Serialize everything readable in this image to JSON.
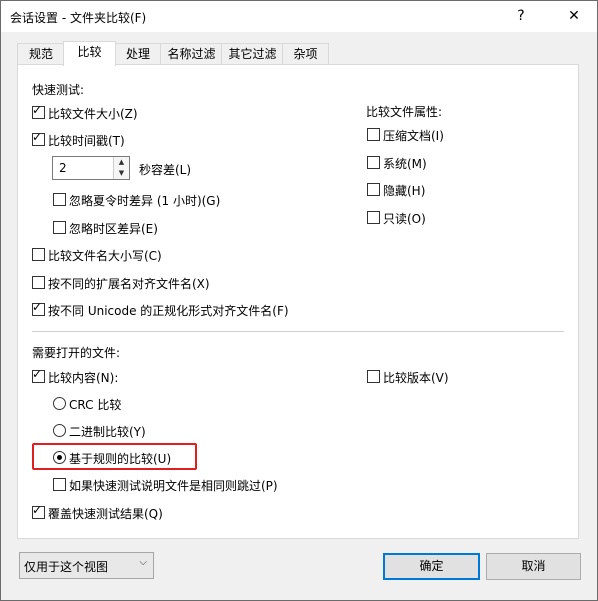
{
  "window": {
    "title": "会话设置 - 文件夹比较(F)",
    "help_label": "?",
    "close_label": "✕"
  },
  "tabs": [
    {
      "label": "规范"
    },
    {
      "label": "比较"
    },
    {
      "label": "处理"
    },
    {
      "label": "名称过滤"
    },
    {
      "label": "其它过滤"
    },
    {
      "label": "杂项"
    }
  ],
  "quick_test": {
    "heading": "快速测试:",
    "compare_size": {
      "label": "比较文件大小(Z)",
      "checked": true
    },
    "compare_timestamp": {
      "label": "比较时间戳(T)",
      "checked": true
    },
    "tolerance_value": "2",
    "tolerance_label": "秒容差(L)",
    "ignore_dst": {
      "label": "忽略夏令时差异 (1 小时)(G)",
      "checked": false
    },
    "ignore_tz": {
      "label": "忽略时区差异(E)",
      "checked": false
    },
    "case_sensitive": {
      "label": "比较文件名大小写(C)",
      "checked": false
    },
    "align_by_ext": {
      "label": "按不同的扩展名对齐文件名(X)",
      "checked": false
    },
    "align_unicode": {
      "label": "按不同 Unicode 的正规化形式对齐文件名(F)",
      "checked": true
    }
  },
  "attributes": {
    "heading": "比较文件属性:",
    "archive": {
      "label": "压缩文档(I)",
      "checked": false
    },
    "system": {
      "label": "系统(M)",
      "checked": false
    },
    "hidden": {
      "label": "隐藏(H)",
      "checked": false
    },
    "readonly": {
      "label": "只读(O)",
      "checked": false
    }
  },
  "open_files": {
    "heading": "需要打开的文件:",
    "compare_contents": {
      "label": "比较内容(N):",
      "checked": true
    },
    "crc": {
      "label": "CRC 比较",
      "selected": false
    },
    "binary": {
      "label": "二进制比较(Y)",
      "selected": false
    },
    "rules": {
      "label": "基于规则的比较(U)",
      "selected": true
    },
    "skip_if_same": {
      "label": "如果快速测试说明文件是相同则跳过(P)",
      "checked": false
    },
    "override_quick": {
      "label": "覆盖快速测试结果(Q)",
      "checked": true
    },
    "compare_versions": {
      "label": "比较版本(V)",
      "checked": false
    }
  },
  "footer": {
    "scope_value": "仅用于这个视图",
    "ok_label": "确定",
    "cancel_label": "取消"
  },
  "colors": {
    "highlight": "#e02020",
    "default_button_border": "#0078d7"
  }
}
